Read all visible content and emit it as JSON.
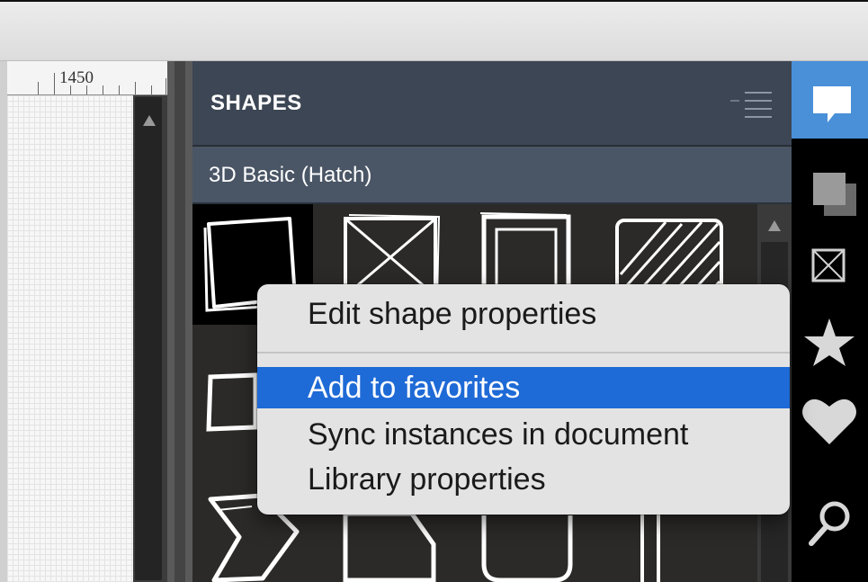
{
  "ruler": {
    "label": "1450"
  },
  "shapes_panel": {
    "title": "SHAPES",
    "library": "3D Basic (Hatch)"
  },
  "context_menu": {
    "items": [
      {
        "label": "Edit shape properties",
        "highlighted": false
      },
      {
        "label": "Add to favorites",
        "highlighted": true
      },
      {
        "label": "Sync instances in document",
        "highlighted": false
      },
      {
        "label": "Library properties",
        "highlighted": false
      }
    ]
  },
  "sidebar_icons": [
    "shapes-icon",
    "layers-icon",
    "image-icon",
    "favorites-icon",
    "heart-icon",
    "search-icon"
  ],
  "colors": {
    "panel_header": "#3c4654",
    "menu_highlight": "#1e6ad6",
    "active_tab": "#4a90d9"
  }
}
